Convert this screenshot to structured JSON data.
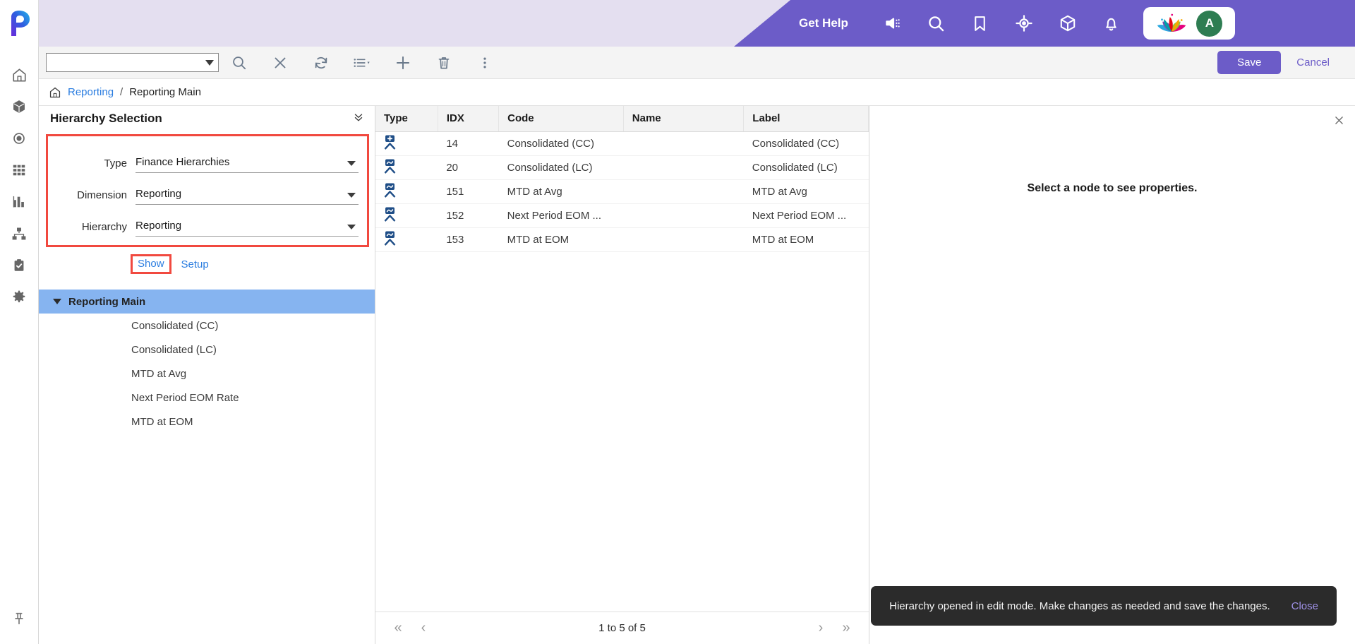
{
  "header": {
    "get_help": "Get Help",
    "icons": [
      {
        "name": "megaphone-icon"
      },
      {
        "name": "search-icon"
      },
      {
        "name": "bookmark-icon"
      },
      {
        "name": "target-icon"
      },
      {
        "name": "cube-icon"
      },
      {
        "name": "bell-icon"
      }
    ],
    "brand_logo": "lotus-logo",
    "avatar_initial": "A",
    "accent_purple": "#6c5cc8",
    "band_lavender": "#e4dff0"
  },
  "rail": {
    "items": [
      {
        "icon": "home-icon",
        "label": "Home"
      },
      {
        "icon": "cube-icon",
        "label": "Models"
      },
      {
        "icon": "target-icon",
        "label": "Focus"
      },
      {
        "icon": "grid-icon",
        "label": "Grid"
      },
      {
        "icon": "bar-chart-icon",
        "label": "Reports"
      },
      {
        "icon": "hierarchy-icon",
        "label": "Hierarchy"
      },
      {
        "icon": "clipboard-check-icon",
        "label": "Tasks"
      },
      {
        "icon": "gear-icon",
        "label": "Settings"
      }
    ],
    "pin": {
      "icon": "pushpin-icon",
      "label": "Pin"
    }
  },
  "toolbar": {
    "search_value": "",
    "search_placeholder": "",
    "buttons": [
      {
        "name": "search-button",
        "icon": "search-icon"
      },
      {
        "name": "clear-button",
        "icon": "close-icon"
      },
      {
        "name": "refresh-button",
        "icon": "refresh-icon"
      },
      {
        "name": "list-view-button",
        "icon": "list-icon"
      },
      {
        "name": "add-button",
        "icon": "plus-icon"
      },
      {
        "name": "delete-button",
        "icon": "trash-icon"
      },
      {
        "name": "more-options-button",
        "icon": "kebab-menu-icon"
      }
    ],
    "save_label": "Save",
    "cancel_label": "Cancel"
  },
  "breadcrumb": {
    "home_icon": "home-icon",
    "parent": "Reporting",
    "separator": "/",
    "current": "Reporting Main"
  },
  "selection_panel": {
    "title": "Hierarchy Selection",
    "collapse_icon": "chevron-double-down-icon",
    "fields": [
      {
        "label": "Type",
        "value": "Finance Hierarchies"
      },
      {
        "label": "Dimension",
        "value": "Reporting"
      },
      {
        "label": "Hierarchy",
        "value": "Reporting"
      }
    ],
    "show_label": "Show",
    "setup_label": "Setup",
    "highlight_color": "#f1493f"
  },
  "tree": {
    "root": {
      "label": "Reporting Main",
      "expanded": true
    },
    "children": [
      {
        "label": "Consolidated (CC)"
      },
      {
        "label": "Consolidated (LC)"
      },
      {
        "label": "MTD at Avg"
      },
      {
        "label": "Next Period EOM Rate"
      },
      {
        "label": "MTD at EOM"
      }
    ]
  },
  "grid": {
    "columns": [
      "Type",
      "IDX",
      "Code",
      "Name",
      "Label"
    ],
    "rows": [
      {
        "type_icon": "node-add-icon",
        "idx": "14",
        "code": "Consolidated (CC)",
        "name": "",
        "label": "Consolidated (CC)"
      },
      {
        "type_icon": "node-calc-icon",
        "idx": "20",
        "code": "Consolidated (LC)",
        "name": "",
        "label": "Consolidated (LC)"
      },
      {
        "type_icon": "node-calc-icon",
        "idx": "151",
        "code": "MTD at Avg",
        "name": "",
        "label": "MTD at Avg"
      },
      {
        "type_icon": "node-calc-icon",
        "idx": "152",
        "code": "Next Period EOM ...",
        "name": "",
        "label": "Next Period EOM ..."
      },
      {
        "type_icon": "node-calc-icon",
        "idx": "153",
        "code": "MTD at EOM",
        "name": "",
        "label": "MTD at EOM"
      }
    ],
    "pager": {
      "first": "«",
      "prev": "‹",
      "label": "1 to 5 of 5",
      "next": "›",
      "last": "»"
    }
  },
  "properties_panel": {
    "close_icon": "close-icon",
    "message": "Select a node to see properties."
  },
  "toast": {
    "message": "Hierarchy opened in edit mode. Make changes as needed and save the changes.",
    "close_label": "Close"
  }
}
